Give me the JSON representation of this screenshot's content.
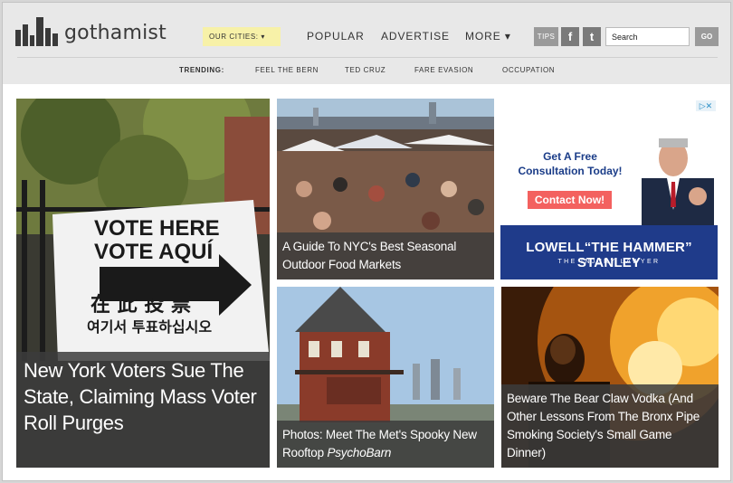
{
  "header": {
    "logo_text": "gothamist",
    "cities_label": "OUR CITIES: ▾",
    "nav": [
      "POPULAR",
      "ADVERTISE",
      "MORE ▾"
    ],
    "tips_label": "TIPS",
    "facebook_glyph": "f",
    "twitter_glyph": "t",
    "search_value": "Search",
    "go_label": "GO"
  },
  "trending": {
    "label": "TRENDING:",
    "items": [
      "FEEL THE BERN",
      "TED CRUZ",
      "FARE EVASION",
      "OCCUPATION"
    ]
  },
  "stories": {
    "voters": "New York Voters Sue The State, Claiming Mass Voter Roll Purges",
    "food_markets": "A Guide To NYC's Best Seasonal Outdoor Food Markets",
    "met_prefix": "Photos: Meet The Met's Spooky New Rooftop ",
    "met_italic": "PsychoBarn",
    "vodka": "Beware The Bear Claw Vodka (And Other Lessons From The Bronx Pipe Smoking Society's Small Game Dinner)"
  },
  "photo_signs": {
    "line1": "VOTE HERE",
    "line2": "VOTE AQUÍ",
    "line3": "在 此 投 票",
    "line4": "여기서 투표하십시오"
  },
  "ad": {
    "headline": "Get A Free Consultation Today!",
    "button": "Contact Now!",
    "name": "LOWELL“THE HAMMER” STANLEY",
    "subtitle": "THE INJURY LAWYER",
    "adchoices": "▷✕"
  }
}
